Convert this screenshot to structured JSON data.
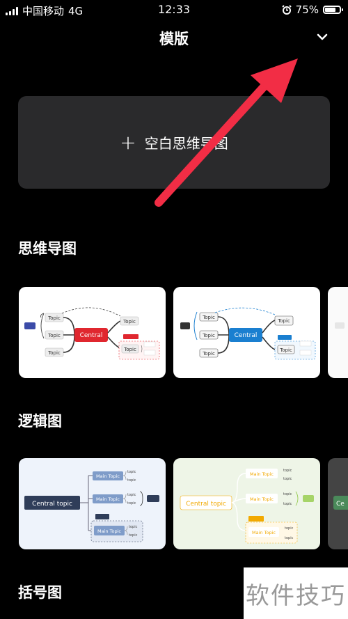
{
  "status_bar": {
    "carrier": "中国移动",
    "network": "4G",
    "time": "12:33",
    "battery": "75%",
    "battery_level": 0.75
  },
  "header": {
    "title": "模版",
    "collapse_icon": "chevron-down-icon"
  },
  "blank_template": {
    "plus": "+",
    "label": "空白思维导图"
  },
  "sections": [
    {
      "title": "思维导图",
      "thumbs": [
        {
          "center": "Central",
          "topic": "Topic",
          "accent": "#e0272f"
        },
        {
          "center": "Central",
          "topic": "Topic",
          "accent": "#1a7fd0"
        }
      ]
    },
    {
      "title": "逻辑图",
      "thumbs": [
        {
          "center": "Central topic",
          "main": "Main Topic",
          "sub": "topic",
          "accent": "#2f3d59"
        },
        {
          "center": "Central topic",
          "main": "Main Topic",
          "sub": "topic",
          "accent": "#f2a900",
          "partial": "Ce"
        }
      ]
    },
    {
      "title": "括号图"
    }
  ],
  "watermark": "软件技巧",
  "colors": {
    "annotation_arrow": "#f22d45",
    "card_bg": "#2a2a2c"
  }
}
